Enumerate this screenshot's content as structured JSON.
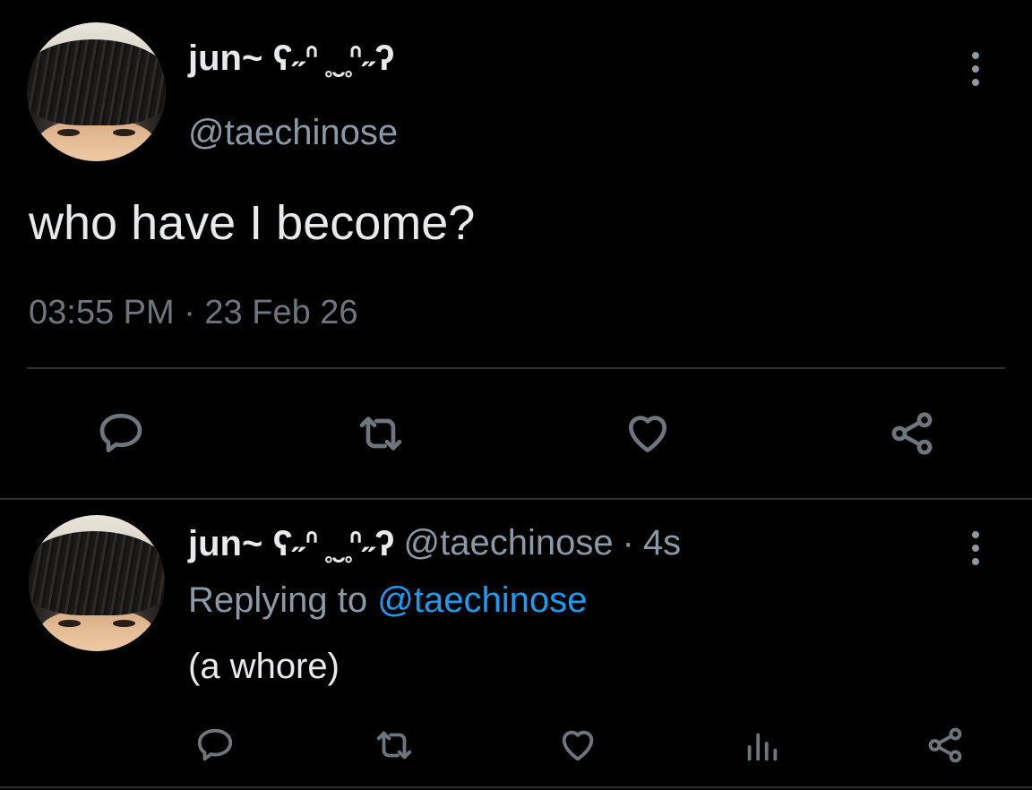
{
  "main_tweet": {
    "display_name": "jun~ ʕ˶ᐢ ̥ ̮ ̥ᐢ˶ʔ",
    "handle": "@taechinose",
    "text": "who have I become?",
    "timestamp": "03:55 PM · 23 Feb 26",
    "actions": [
      "reply-icon",
      "retweet-icon",
      "like-icon",
      "share-icon"
    ]
  },
  "reply_tweet": {
    "display_name": "jun~ ʕ˶ᐢ ̥ ̮ ̥ᐢ˶ʔ",
    "handle": "@taechinose",
    "separator": "·",
    "time_ago": "4s",
    "replying_to_label": "Replying to",
    "replying_to_handle": "@taechinose",
    "text": "(a whore)",
    "actions": [
      "reply-icon",
      "retweet-icon",
      "like-icon",
      "analytics-icon",
      "share-icon"
    ]
  },
  "colors": {
    "background": "#000000",
    "primary_text": "#e7e9ea",
    "secondary_text": "#8b98a5",
    "muted": "#6e767d",
    "link": "#1d9bf0",
    "divider": "#2f3336"
  }
}
